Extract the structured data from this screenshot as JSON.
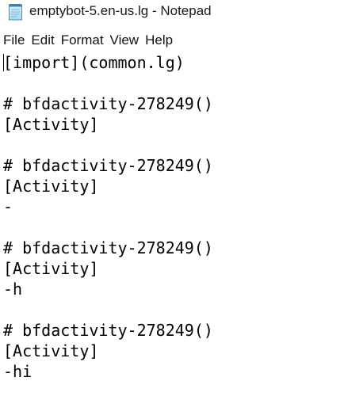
{
  "window": {
    "title": "emptybot-5.en-us.lg - Notepad",
    "icon": "notepad-icon"
  },
  "menu": {
    "items": [
      "File",
      "Edit",
      "Format",
      "View",
      "Help"
    ]
  },
  "editor": {
    "lines": [
      "[import](common.lg)",
      "",
      "",
      "# bfdactivity-278249()",
      "[Activity]",
      "",
      "# bfdactivity-278249()",
      "[Activity]",
      "-",
      "",
      "# bfdactivity-278249()",
      "[Activity]",
      "-h",
      "",
      "# bfdactivity-278249()",
      "[Activity]",
      "-hi"
    ]
  }
}
